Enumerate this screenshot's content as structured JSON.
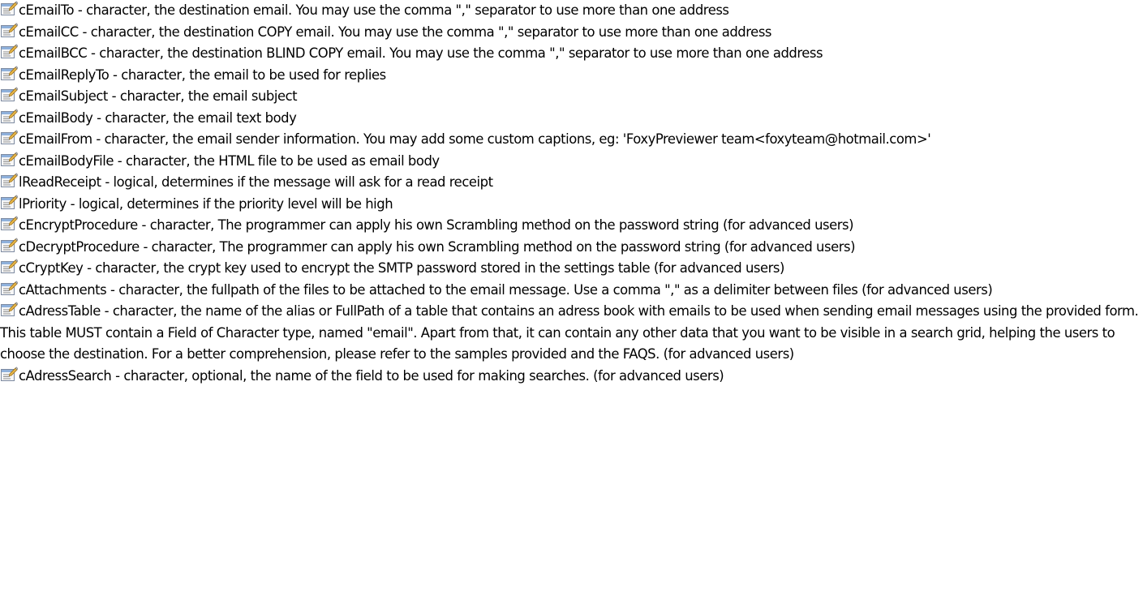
{
  "icon": "property-icon",
  "properties": [
    {
      "name": "cEmailTo",
      "text": "cEmailTo - character, the destination email. You may use the comma \",\" separator to use more than one address"
    },
    {
      "name": "cEmailCC",
      "text": "cEmailCC - character, the destination COPY email. You may use the comma \",\" separator to use more than one address"
    },
    {
      "name": "cEmailBCC",
      "text": "cEmailBCC - character, the destination BLIND COPY email. You may use the comma \",\" separator to use more than one address"
    },
    {
      "name": "cEmailReplyTo",
      "text": "cEmailReplyTo - character, the email to be used for replies"
    },
    {
      "name": "cEmailSubject",
      "text": "cEmailSubject - character, the email subject"
    },
    {
      "name": "cEmailBody",
      "text": "cEmailBody - character, the email text body"
    },
    {
      "name": "cEmailFrom",
      "text": "cEmailFrom - character, the email sender information. You may add some custom captions, eg: 'FoxyPreviewer team<foxyteam@hotmail.com>'"
    },
    {
      "name": "cEmailBodyFile",
      "text": "cEmailBodyFile - character, the HTML file to be used as email body"
    },
    {
      "name": "lReadReceipt",
      "text": "lReadReceipt - logical, determines if the message will ask for a read receipt"
    },
    {
      "name": "lPriority",
      "text": "lPriority - logical, determines if the priority level will be high"
    },
    {
      "name": "cEncryptProcedure",
      "text": "cEncryptProcedure - character, The programmer can apply his own Scrambling method on the password string (for advanced users)"
    },
    {
      "name": "cDecryptProcedure",
      "text": "cDecryptProcedure - character, The programmer can apply his own Scrambling method on the password string (for advanced users)"
    },
    {
      "name": "cCryptKey",
      "text": "cCryptKey - character, the crypt key used to encrypt the SMTP password stored in the settings table (for advanced users)"
    },
    {
      "name": "cAttachments",
      "text": "cAttachments - character, the fullpath of the files to be attached to the email message. Use a comma \",\" as a delimiter between files (for advanced users)"
    },
    {
      "name": "cAdressTable",
      "text": "cAdressTable - character, the name of the alias or FullPath of a table that contains an adress book with emails to be used when sending email messages using the provided form. This table MUST contain a Field of Character type, named \"email\". Apart from that, it can contain any other data that you want to be visible in a search grid, helping the users to choose the destination. For a better comprehension, please refer to the samples provided and the FAQS. (for advanced users)"
    },
    {
      "name": "cAdressSearch",
      "text": "cAdressSearch - character, optional, the name of the field to be used for making searches. (for advanced users)"
    }
  ]
}
